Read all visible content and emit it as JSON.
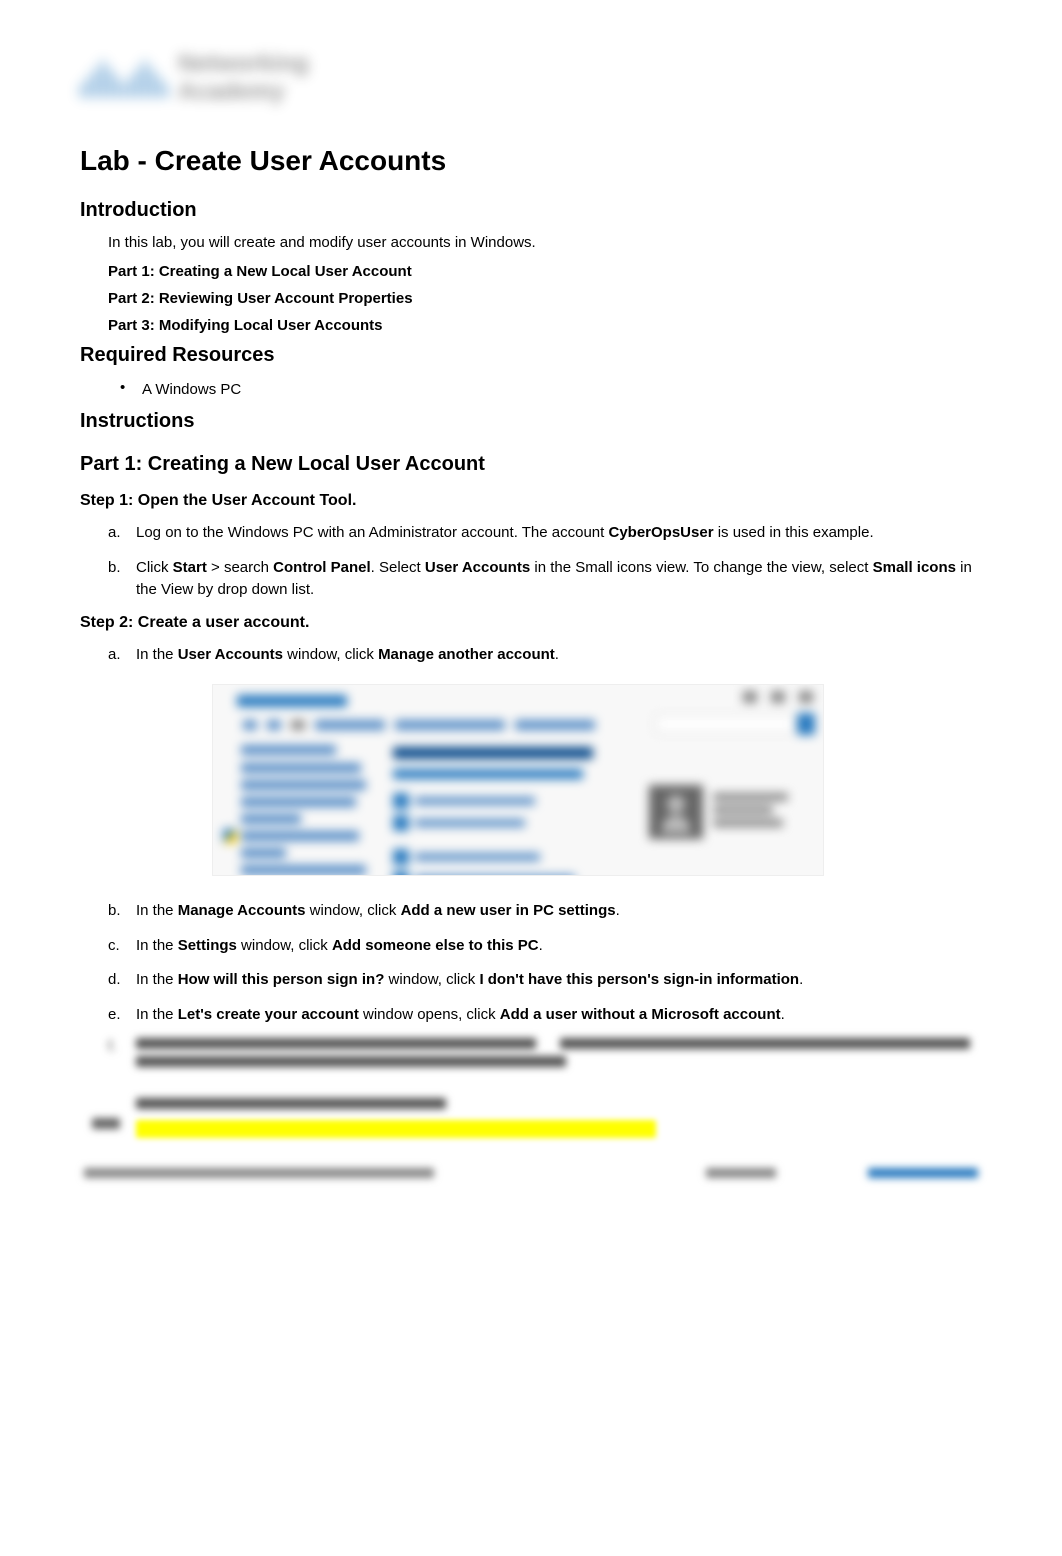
{
  "logo": {
    "brand": "cisco",
    "line1": "Networking",
    "line2": "Academy"
  },
  "page_title": "Lab - Create User Accounts",
  "introduction": {
    "heading": "Introduction",
    "text": "In this lab, you will create and modify user accounts in Windows.",
    "parts": [
      "Part 1: Creating a New Local User Account",
      "Part 2: Reviewing User Account Properties",
      "Part 3: Modifying Local User Accounts"
    ]
  },
  "required_resources": {
    "heading": "Required Resources",
    "items": [
      "A Windows PC"
    ]
  },
  "instructions": {
    "heading": "Instructions"
  },
  "part1": {
    "heading": "Part 1: Creating a New Local User Account",
    "step1": {
      "heading": "Step 1: Open the User Account Tool.",
      "a": {
        "pre": "Log on to the Windows PC with an Administrator account. The account ",
        "bold1": "CyberOpsUser",
        "post": " is used in this example."
      },
      "b": {
        "t1": "Click ",
        "b1": "Start",
        "t2": " > search ",
        "b2": "Control Panel",
        "t3": ". Select ",
        "b3": "User Accounts",
        "t4": " in the Small icons view. To change the view, select ",
        "b4": "Small icons",
        "t5": " in the View by drop down list."
      }
    },
    "step2": {
      "heading": "Step 2: Create a user account.",
      "a": {
        "t1": "In the ",
        "b1": "User Accounts",
        "t2": " window, click ",
        "b2": "Manage another account",
        "t3": "."
      },
      "b": {
        "t1": "In the ",
        "b1": "Manage Accounts",
        "t2": " window, click ",
        "b2": "Add a new user in PC settings",
        "t3": "."
      },
      "c": {
        "t1": "In the ",
        "b1": "Settings",
        "t2": " window, click ",
        "b2": "Add someone else to this PC",
        "t3": "."
      },
      "d": {
        "t1": "In the ",
        "b1": "How will this person sign in?",
        "t2": " window, click ",
        "b2": "I don't have this person's sign-in information",
        "t3": "."
      },
      "e": {
        "t1": "In the ",
        "b1": "Let's create your account",
        "t2": " window opens, click ",
        "b2": "Add a user without a Microsoft account",
        "t3": "."
      }
    }
  },
  "screenshot": {
    "window_title": "User Accounts",
    "breadcrumb": [
      "Control Panel",
      "All Control Panel Items",
      "User Accounts"
    ],
    "search_placeholder": "Search Control Panel",
    "left_panel": [
      "Control Panel Home",
      "Manage your credentials",
      "Create a password reset disk",
      "Manage your file encryption certificates",
      "Configure advanced user profile properties",
      "Change my environment variables"
    ],
    "main_heading": "Make changes to your user account",
    "main_link": "Make changes to my account in PC settings",
    "actions": [
      "Change your account name",
      "Change your account type",
      "Manage another account",
      "Change User Account Control settings"
    ],
    "account_name": "CyberOpsUser",
    "account_type": "Local Account",
    "account_role": "Administrator"
  },
  "footer": {
    "copyright": "© 2018 - 2019 Cisco and/or its affiliates. All rights reserved. Cisco Public",
    "page": "Page 1 of 5",
    "link": "www.netacad.com"
  }
}
